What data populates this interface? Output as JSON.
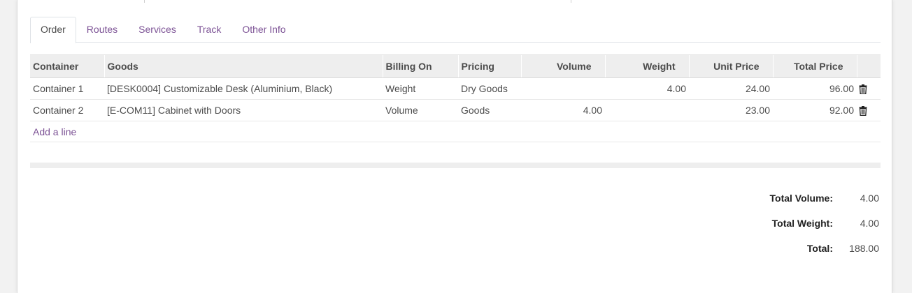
{
  "tabs": [
    {
      "label": "Order",
      "active": true
    },
    {
      "label": "Routes",
      "active": false
    },
    {
      "label": "Services",
      "active": false
    },
    {
      "label": "Track",
      "active": false
    },
    {
      "label": "Other Info",
      "active": false
    }
  ],
  "table": {
    "columns": [
      "Container",
      "Goods",
      "Billing On",
      "Pricing",
      "Volume",
      "Weight",
      "Unit Price",
      "Total Price"
    ],
    "rows": [
      {
        "container": "Container 1",
        "goods": "[DESK0004] Customizable Desk (Aluminium, Black)",
        "billing_on": "Weight",
        "pricing": "Dry Goods",
        "volume": "",
        "weight": "4.00",
        "unit_price": "24.00",
        "total_price": "96.00"
      },
      {
        "container": "Container 2",
        "goods": "[E-COM11] Cabinet with Doors",
        "billing_on": "Volume",
        "pricing": "Goods",
        "volume": "4.00",
        "weight": "",
        "unit_price": "23.00",
        "total_price": "92.00"
      }
    ],
    "add_line": "Add a line"
  },
  "totals": {
    "volume_label": "Total Volume:",
    "volume_value": "4.00",
    "weight_label": "Total Weight:",
    "weight_value": "4.00",
    "total_label": "Total:",
    "total_value": "188.00"
  },
  "colors": {
    "link": "#7c5295",
    "header_bg": "#eeeeee"
  },
  "icons": {
    "row_delete": "trash-icon"
  }
}
